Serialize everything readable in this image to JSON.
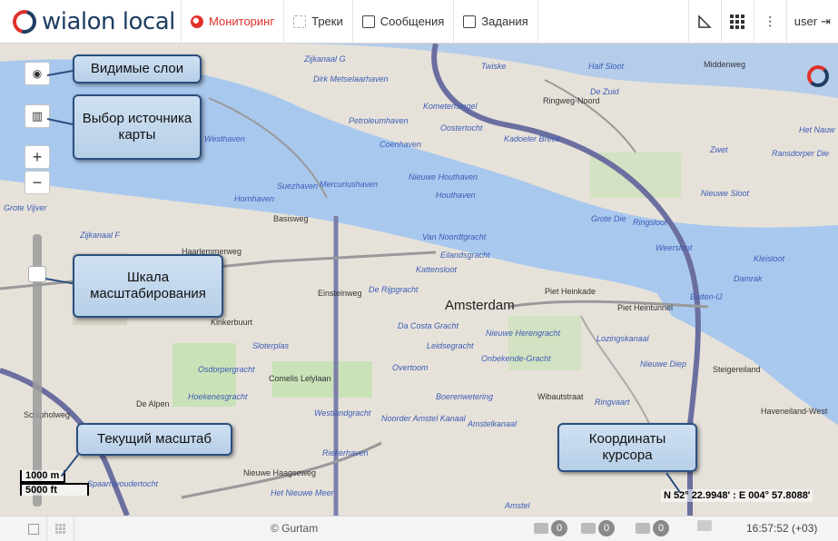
{
  "header": {
    "logo_text": "wialon local",
    "nav": [
      {
        "label": "Мониторинг",
        "icon": "globe-icon",
        "active": true
      },
      {
        "label": "Треки",
        "icon": "track-icon",
        "active": false
      },
      {
        "label": "Сообщения",
        "icon": "messages-icon",
        "active": false
      },
      {
        "label": "Задания",
        "icon": "tasks-icon",
        "active": false
      }
    ],
    "tools": {
      "measure_icon": "ruler-icon",
      "apps_icon": "apps-grid-icon",
      "more": "⋮"
    },
    "user": "user"
  },
  "map": {
    "controls": {
      "layers_icon": "eye-icon",
      "source_icon": "map-icon",
      "zoom_in": "+",
      "zoom_out": "−"
    },
    "city_label": "Amsterdam",
    "labels": [
      "Zijkanaal G",
      "Dirk Metselaarhaven",
      "Twiske",
      "Half Sloot",
      "De Zuid",
      "Middenweg",
      "Petroleumhaven",
      "Kometensingel",
      "Oostertocht",
      "Kadoeler Breek",
      "Coenhaven",
      "Westhaven",
      "Zwet",
      "Ransdorper Die",
      "Het Nauw",
      "Suezhaven",
      "Mercuriushaven",
      "Nieuwe Houthaven",
      "Houthaven",
      "Nieuwe Sloot",
      "Hornhaven",
      "Grote Die",
      "Ringsloot",
      "Basisweg",
      "Van Noordtgracht",
      "Eilandsgracht",
      "Kattensloot",
      "Weersloot",
      "Kleisloot",
      "Damrak",
      "De Rijpgracht",
      "Piet Heinkade",
      "Piet Heintunnel",
      "Buiten-IJ",
      "Kinkerbuurt",
      "Da Costa Gracht",
      "Nieuwe Herengracht",
      "Leidsegracht",
      "Lozingskanaal",
      "Sloterplas",
      "Onbekende-Gracht",
      "Nieuwe Diep",
      "Osdorpergracht",
      "Comelis Lelylaan",
      "Overtoom",
      "Steigereiland",
      "Hoekenesgracht",
      "Boerenwetering",
      "Ringvaart",
      "Westlandgracht",
      "Noorder Amstel Kanaal",
      "Amstelkanaal",
      "Haveneiland-West",
      "Riekerhaven",
      "Nieuwe Haagseweg",
      "Spaarnwoudertocht",
      "Het Nieuwe Meer",
      "Amstel",
      "Grote Vijver",
      "Zijkanaal F",
      "Haarlemmerweg",
      "De Alpen",
      "Schipholweg",
      "Einsteinweg",
      "Wibautstraat",
      "Ringweg-Noord"
    ],
    "scale": {
      "metric": "1000 m",
      "imperial": "5000 ft"
    },
    "coords": "N 52° 22.9948' : E 004° 57.8088'"
  },
  "callouts": {
    "layers": "Видимые слои",
    "source": "Выбор источника карты",
    "zoom_scale": "Шкала масштабирования",
    "current_scale": "Текущий масштаб",
    "cursor_coords": "Координаты курсора"
  },
  "footer": {
    "copyright": "© Gurtam",
    "counters": [
      {
        "icon": "messages-counter-icon",
        "value": "0"
      },
      {
        "icon": "notifications-counter-icon",
        "value": "0"
      },
      {
        "icon": "events-counter-icon",
        "value": "0"
      }
    ],
    "time": "16:57:52 (+03)"
  }
}
